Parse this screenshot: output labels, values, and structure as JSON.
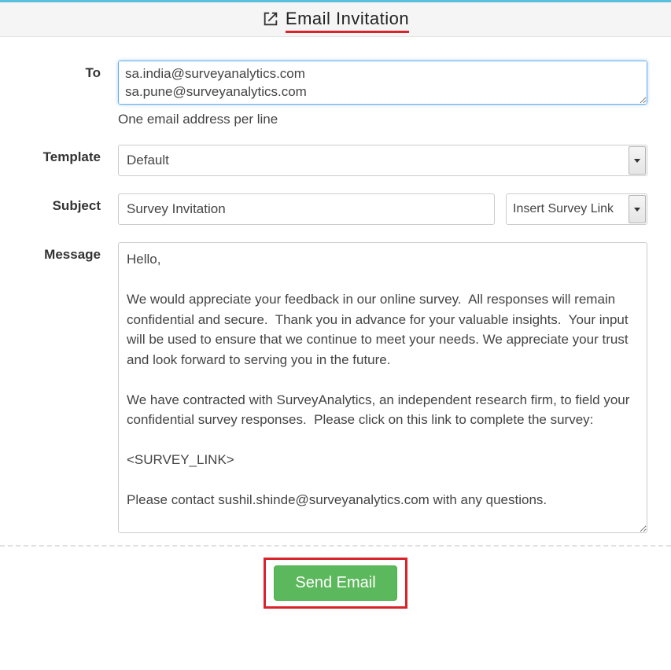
{
  "header": {
    "title": "Email Invitation"
  },
  "form": {
    "to": {
      "label": "To",
      "value": "sa.india@surveyanalytics.com\nsa.pune@surveyanalytics.com",
      "hint": "One email address per line"
    },
    "template": {
      "label": "Template",
      "selected": "Default"
    },
    "subject": {
      "label": "Subject",
      "value": "Survey Invitation",
      "insert_label": "Insert Survey Link"
    },
    "message": {
      "label": "Message",
      "value": "Hello,\n\nWe would appreciate your feedback in our online survey.  All responses will remain confidential and secure.  Thank you in advance for your valuable insights.  Your input will be used to ensure that we continue to meet your needs. We appreciate your trust and look forward to serving you in the future.\n\nWe have contracted with SurveyAnalytics, an independent research firm, to field your confidential survey responses.  Please click on this link to complete the survey:\n\n<SURVEY_LINK>\n\nPlease contact sushil.shinde@surveyanalytics.com with any questions."
    }
  },
  "actions": {
    "send": "Send Email"
  }
}
